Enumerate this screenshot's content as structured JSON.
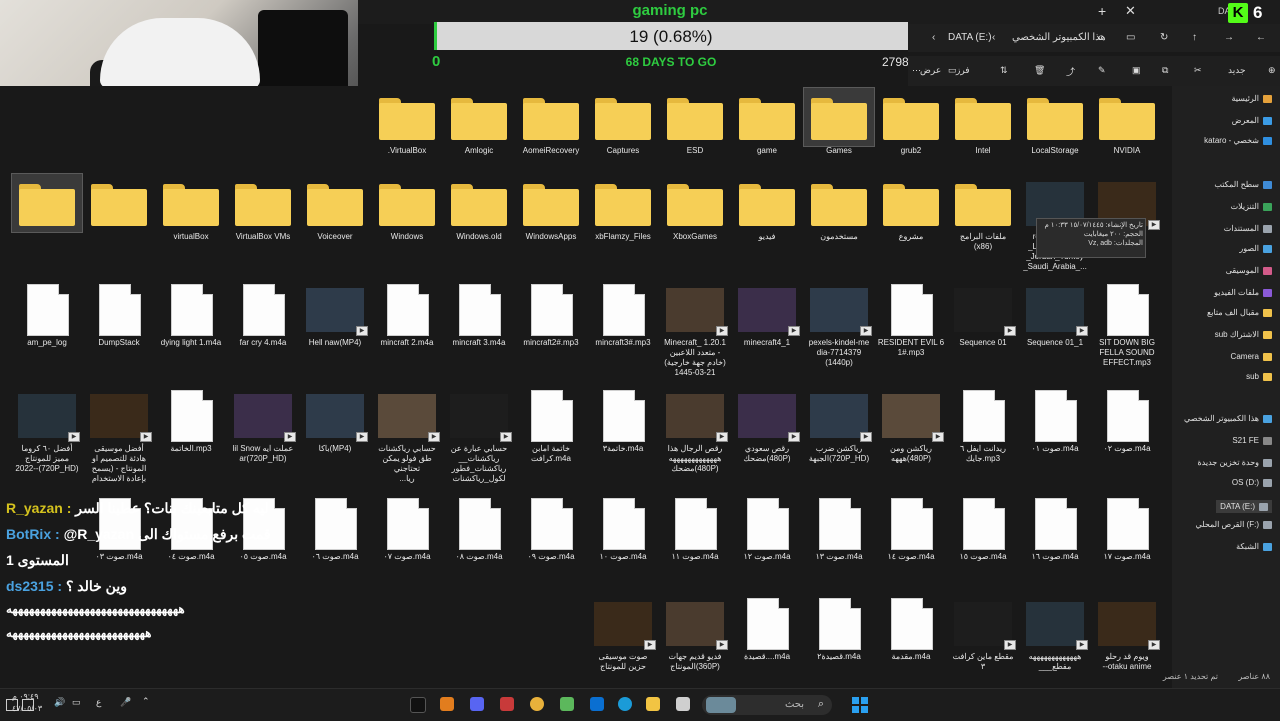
{
  "overlay": {
    "title": "gaming pc",
    "progress_text": "19 (0.68%)",
    "progress_fraction": 0.0068,
    "min_label": "0",
    "days_label": "68 DAYS TO GO",
    "max_label": "2798",
    "badge_k": "K",
    "badge_count": "6",
    "data_text": "DA"
  },
  "explorer": {
    "tab_plus": "+",
    "tab_close": "✕",
    "breadcrumb": [
      "هذا الكمبيوتر الشخصي",
      "DATA (E:)"
    ],
    "toolbar": {
      "new": "جديد",
      "sort": "فرز",
      "view": "عرض"
    },
    "rows": [
      [
        {
          "n": "NVIDIA",
          "t": "folder"
        },
        {
          "n": "LocalStorage",
          "t": "folder"
        },
        {
          "n": "Intel",
          "t": "folder"
        },
        {
          "n": "grub2",
          "t": "folder"
        },
        {
          "n": "Games",
          "t": "folder",
          "sel": true
        },
        {
          "n": "game",
          "t": "folder"
        },
        {
          "n": "ESD",
          "t": "folder"
        },
        {
          "n": "Captures",
          "t": "folder"
        },
        {
          "n": "AomeiRecovery",
          "t": "folder"
        },
        {
          "n": "Amlogic",
          "t": "folder"
        },
        {
          "n": ".VirtualBox",
          "t": "folder"
        }
      ],
      [
        {
          "n": "11",
          "t": "thumb"
        },
        {
          "n": "reels_Syria_\n_Lebanon_Iraq\n_Jordan_Turkey\n_Saudi_Arabia_...",
          "t": "thumb"
        },
        {
          "n": "ملفات البرامج\n(x86)",
          "t": "folder"
        },
        {
          "n": "مشروع",
          "t": "folder"
        },
        {
          "n": "مستخدمون",
          "t": "folder"
        },
        {
          "n": "فيديو",
          "t": "folder"
        },
        {
          "n": "XboxGames",
          "t": "folder"
        },
        {
          "n": "xbFlamzy_Files",
          "t": "folder"
        },
        {
          "n": "WindowsApps",
          "t": "folder"
        },
        {
          "n": "Windows.old",
          "t": "folder"
        },
        {
          "n": "Windows",
          "t": "folder"
        },
        {
          "n": "Voiceover",
          "t": "folder"
        },
        {
          "n": "VirtualBox VMs",
          "t": "folder"
        },
        {
          "n": "virtualBox",
          "t": "folder"
        },
        {
          "n": "",
          "t": "folder"
        },
        {
          "n": "",
          "t": "folder",
          "sel": true
        }
      ],
      [
        {
          "n": "SIT DOWN BIG\nFELLA SOUND\nEFFECT.mp3",
          "t": "file"
        },
        {
          "n": "Sequence 01_1",
          "t": "thumb"
        },
        {
          "n": "Sequence 01",
          "t": "thumb"
        },
        {
          "n": "RESIDENT EVIL 6\n1#.mp3",
          "t": "file"
        },
        {
          "n": "pexels-kindel-me\ndia-7714379\n(1440p)",
          "t": "thumb"
        },
        {
          "n": "minecraft4_1",
          "t": "thumb"
        },
        {
          "n": "Minecraft_ 1.20.1\nمتعدد اللاعبين -\n(خادم جهة خارجية)\n1445-03-21",
          "t": "thumb"
        },
        {
          "n": "mincraft3#.mp3",
          "t": "file"
        },
        {
          "n": "mincraft2#.mp3",
          "t": "file"
        },
        {
          "n": "mincraft 3.m4a",
          "t": "file"
        },
        {
          "n": "mincraft 2.m4a",
          "t": "file"
        },
        {
          "n": "Hell naw(MP4)",
          "t": "thumb"
        },
        {
          "n": "far cry 4.m4a",
          "t": "file"
        },
        {
          "n": "dying light 1.m4a",
          "t": "file"
        },
        {
          "n": "DumpStack",
          "t": "file"
        },
        {
          "n": "am_pe_log",
          "t": "file"
        }
      ],
      [
        {
          "n": "صوت ٠٢.m4a",
          "t": "file"
        },
        {
          "n": "صوت ٠١.m4a",
          "t": "file"
        },
        {
          "n": "ريدانت ايفل ٦\nجايك.mp3",
          "t": "file"
        },
        {
          "n": "رياكشن ومن\nهههه(480P)",
          "t": "thumb"
        },
        {
          "n": "رياكشن ضرب\nالجبهة(720P_HD)",
          "t": "thumb"
        },
        {
          "n": "رقص سعودي\nمضحك(480P)",
          "t": "thumb"
        },
        {
          "n": "رقص الرجال هذا\nهههههههههههههه\nمضحك(480P)",
          "t": "thumb"
        },
        {
          "n": "خاتمة٣.m4a",
          "t": "file"
        },
        {
          "n": "خاتمة امابن\nكرافت.m4a",
          "t": "file"
        },
        {
          "n": "حسابي عبارة عن\n__رياكشنات\nرياكشنات_فطور\nلكول_رياكشنات",
          "t": "thumb"
        },
        {
          "n": "حسابي رياكشنات\nطق فولو يمكن\nتحتاجني\n...ريا",
          "t": "thumb"
        },
        {
          "n": "باكا(MP4)",
          "t": "thumb"
        },
        {
          "n": "lil Snow عملت ايه\nar(720P_HD)",
          "t": "thumb"
        },
        {
          "n": "الخاتمة.mp3",
          "t": "file"
        },
        {
          "n": "أفضل موسيقى\nهادئة للتصميم او\nالمونتاج - (يسمح\nبإعادة الاستخدام",
          "t": "thumb"
        },
        {
          "n": "أفضل ٦٠ كروما\nمميز للمونتاج\n2022--(720P_HD)",
          "t": "thumb"
        }
      ],
      [
        {
          "n": "صوت ١٧.m4a",
          "t": "file"
        },
        {
          "n": "صوت ١٦.m4a",
          "t": "file"
        },
        {
          "n": "صوت ١٥.m4a",
          "t": "file"
        },
        {
          "n": "صوت ١٤.m4a",
          "t": "file"
        },
        {
          "n": "صوت ١٣.m4a",
          "t": "file"
        },
        {
          "n": "صوت ١٢.m4a",
          "t": "file"
        },
        {
          "n": "صوت ١١.m4a",
          "t": "file"
        },
        {
          "n": "صوت ١٠.m4a",
          "t": "file"
        },
        {
          "n": "صوت ٠٩.m4a",
          "t": "file"
        },
        {
          "n": "صوت ٠٨.m4a",
          "t": "file"
        },
        {
          "n": "صوت ٠٧.m4a",
          "t": "file"
        },
        {
          "n": "صوت ٠٦.m4a",
          "t": "file"
        },
        {
          "n": "صوت ٠٥.m4a",
          "t": "file"
        },
        {
          "n": "صوت ٠٤.m4a",
          "t": "file"
        },
        {
          "n": "صوت ٠٣.m4a",
          "t": "file"
        }
      ],
      [
        {
          "n": "ويوم قد رحلو\n--otaku anime",
          "t": "thumb"
        },
        {
          "n": "هههههههههههههه\n___مفطع",
          "t": "thumb"
        },
        {
          "n": "مقطع ماين كرافت\n٣",
          "t": "thumb"
        },
        {
          "n": "مقدمة.m4a",
          "t": "file"
        },
        {
          "n": "قصيدة٢.m4a",
          "t": "file"
        },
        {
          "n": "قصيدة....m4a",
          "t": "file"
        },
        {
          "n": "فديو قديم جهات\nالمونتاج(360P)",
          "t": "thumb"
        },
        {
          "n": "صوت موسيقى\nحزين للمونتاج",
          "t": "thumb"
        }
      ]
    ],
    "tooltip": "تاريخ الإنشاء: ١٥/٠٧/١٤٤٥ ١٠:٣٣ م\nالحجم: ٢٠٠ ميغابايت\nالمجلدات: Vz, adb",
    "sidebar": [
      {
        "label": "الرئيسية",
        "color": "#e5a13b"
      },
      {
        "label": "المعرض",
        "color": "#3b9be5"
      },
      {
        "label": "kataro - شخصي",
        "color": "#2f8fe0"
      },
      {
        "label": "سطح المكتب",
        "color": "#3f8bd6"
      },
      {
        "label": "التنزيلات",
        "color": "#3aa35a"
      },
      {
        "label": "المستندات",
        "color": "#9aa3ad"
      },
      {
        "label": "الصور",
        "color": "#4aa2e0"
      },
      {
        "label": "الموسيقى",
        "color": "#d35b8a"
      },
      {
        "label": "ملفات الفيديو",
        "color": "#8b5ad8"
      },
      {
        "label": "مقبال الف متابع",
        "color": "#f0c24b"
      },
      {
        "label": "sub الاشتراك",
        "color": "#f0c24b"
      },
      {
        "label": "Camera",
        "color": "#f0c24b"
      },
      {
        "label": "sub",
        "color": "#f0c24b"
      },
      {
        "label": "هذا الكمبيوتر الشخصي",
        "color": "#4aa2e0"
      },
      {
        "label": "S21 FE",
        "color": "#888"
      },
      {
        "label": "وحدة تخزين جديدة",
        "color": "#9aa3ad"
      },
      {
        "label": "OS (D:)",
        "color": "#9aa3ad"
      },
      {
        "label": "DATA (E:)",
        "color": "#9aa3ad",
        "active": true
      },
      {
        "label": "القرص المحلي (F:)",
        "color": "#9aa3ad"
      },
      {
        "label": "الشبكة",
        "color": "#4aa2e0"
      }
    ],
    "status_items": "٨٨ عناصر",
    "status_selected": "تم تحديد ١ عنصر"
  },
  "chat": [
    {
      "name": "R_yazan",
      "sep": " : ",
      "text": "ليه كل متابعينك بنات؟ عطينا السر",
      "color": "#d4c21e"
    },
    {
      "name": "BotRix",
      "sep": " : ",
      "text": "@R_yazan قمت برفع مستواك الى",
      "color": "#4aa2e0"
    },
    {
      "name": "",
      "sep": "",
      "text": "المستوى 1",
      "color": "#fff"
    },
    {
      "name": "ds2315",
      "sep": " : ",
      "text": "وين خالد ؟",
      "color": "#4aa2e0"
    },
    {
      "name": "",
      "sep": "",
      "text": "هههههههههههههههههههههههههههههههه",
      "color": "#fff"
    },
    {
      "name": "",
      "sep": "",
      "text": "هههههههههههههههههههههههههه",
      "color": "#fff"
    }
  ],
  "taskbar": {
    "search_placeholder": "بحث",
    "clock": "٠٩:٤٩ م",
    "date": "٤٧/٠٥/٠٣",
    "lang": "ع"
  }
}
